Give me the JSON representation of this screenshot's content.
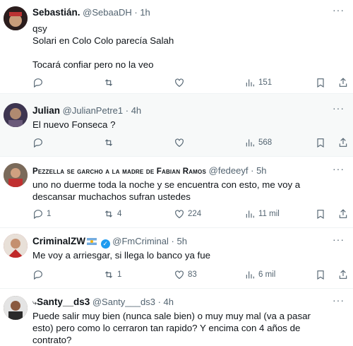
{
  "tweets": [
    {
      "name": "Sebastián.",
      "handle": "@SebaaDH",
      "time": "1h",
      "text": "qsy\nSolari en Colo Colo parecía Salah\n\nTocará confiar pero no la veo",
      "replies": "",
      "retweets": "",
      "likes": "",
      "views": "151",
      "avatar_color": "#3a2a2a"
    },
    {
      "name": "Julian",
      "handle": "@JulianPetre1",
      "time": "4h",
      "text": "El nuevo Fonseca ?",
      "replies": "",
      "retweets": "",
      "likes": "",
      "views": "568",
      "avatar_color": "#4a3f5a"
    },
    {
      "name": "Pezzella se garcho a la madre de Fabian Ramos",
      "handle": "@fedeeyf",
      "time": "5h",
      "text": "uno no duerme toda la noche y se encuentra con esto, me voy a descansar muchachos sufran ustedes",
      "replies": "1",
      "retweets": "4",
      "likes": "224",
      "views": "11 mil",
      "avatar_color": "#8a6a55"
    },
    {
      "name": "CriminalZW",
      "handle": "@FmCriminal",
      "time": "5h",
      "text": "Me voy a arriesgar, si llega lo banco ya fue",
      "replies": "",
      "retweets": "1",
      "likes": "83",
      "views": "6 mil",
      "avatar_color": "#a03a3a"
    },
    {
      "name": "Santy__ds3",
      "handle": "@Santy___ds3",
      "time": "4h",
      "text": "Puede salir muy bien (nunca sale bien) o muy muy mal (va a pasar esto) pero como lo cerraron tan rapido? Y encima con 4 años de contrato?",
      "avatar_color": "#5a4636"
    }
  ],
  "ui": {
    "sep": "·",
    "more": "···"
  }
}
